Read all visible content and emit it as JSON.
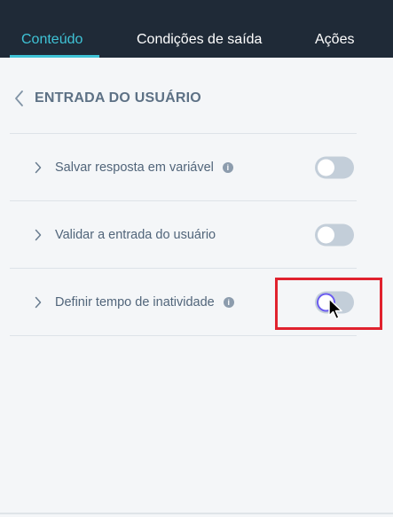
{
  "tabs": [
    {
      "label": "Conteúdo",
      "active": true
    },
    {
      "label": "Condições de saída",
      "active": false
    },
    {
      "label": "Ações",
      "active": false
    }
  ],
  "section": {
    "title": "ENTRADA DO USUÁRIO",
    "back_icon": "chevron-left-icon"
  },
  "rows": [
    {
      "label": "Salvar resposta em variável",
      "has_info": true,
      "info_glyph": "i",
      "toggle_on": false
    },
    {
      "label": "Validar a entrada do usuário",
      "has_info": false,
      "toggle_on": false
    },
    {
      "label": "Definir tempo de inatividade",
      "has_info": true,
      "info_glyph": "i",
      "toggle_on": false
    }
  ],
  "colors": {
    "header_bg": "#1f2a37",
    "accent": "#3fc3d6",
    "highlight": "#e0222e",
    "toggle_off": "#c3ced9"
  }
}
